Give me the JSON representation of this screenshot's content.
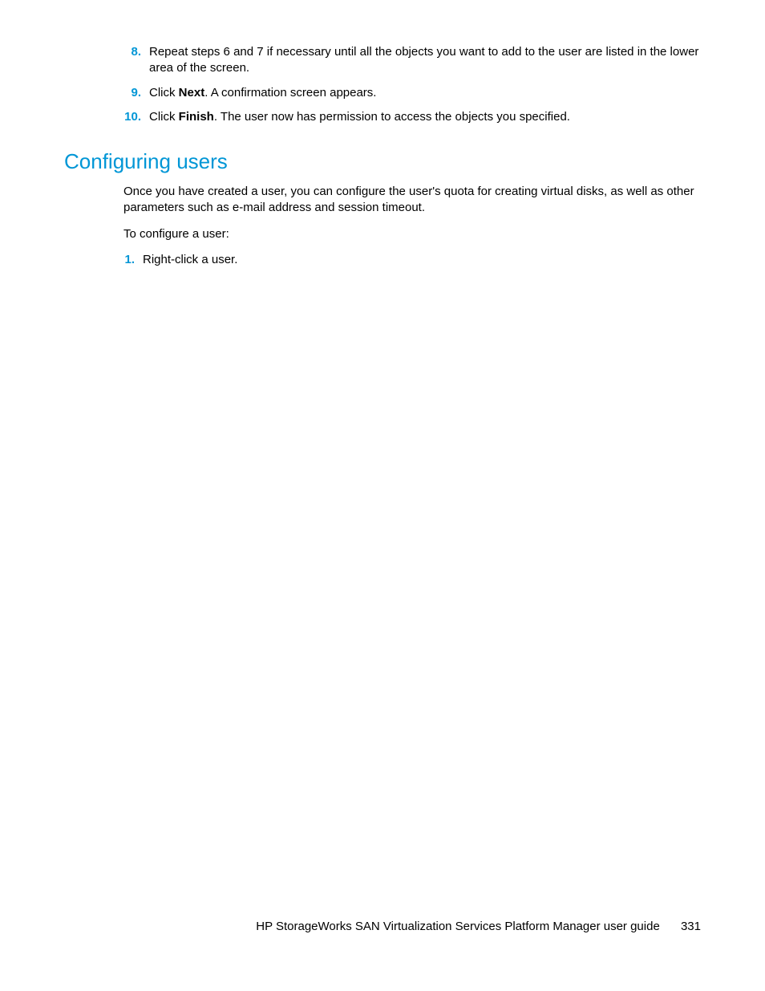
{
  "steps_top": [
    {
      "num": "8.",
      "text": "Repeat steps 6 and 7 if necessary until all the objects you want to add to the user are listed in the lower area of the screen."
    },
    {
      "num": "9.",
      "prefix": "Click ",
      "bold": "Next",
      "suffix": ". A confirmation screen appears."
    },
    {
      "num": "10.",
      "prefix": "Click ",
      "bold": "Finish",
      "suffix": ". The user now has permission to access the objects you specified."
    }
  ],
  "section_heading": "Configuring users",
  "intro_para": "Once you have created a user, you can configure the user's quota for creating virtual disks, as well as other parameters such as e-mail address and session timeout.",
  "lead_in": "To configure a user:",
  "steps_sub": [
    {
      "num": "1.",
      "text": "Right-click a user."
    }
  ],
  "footer_title": "HP StorageWorks SAN Virtualization Services Platform Manager user guide",
  "page_number": "331"
}
